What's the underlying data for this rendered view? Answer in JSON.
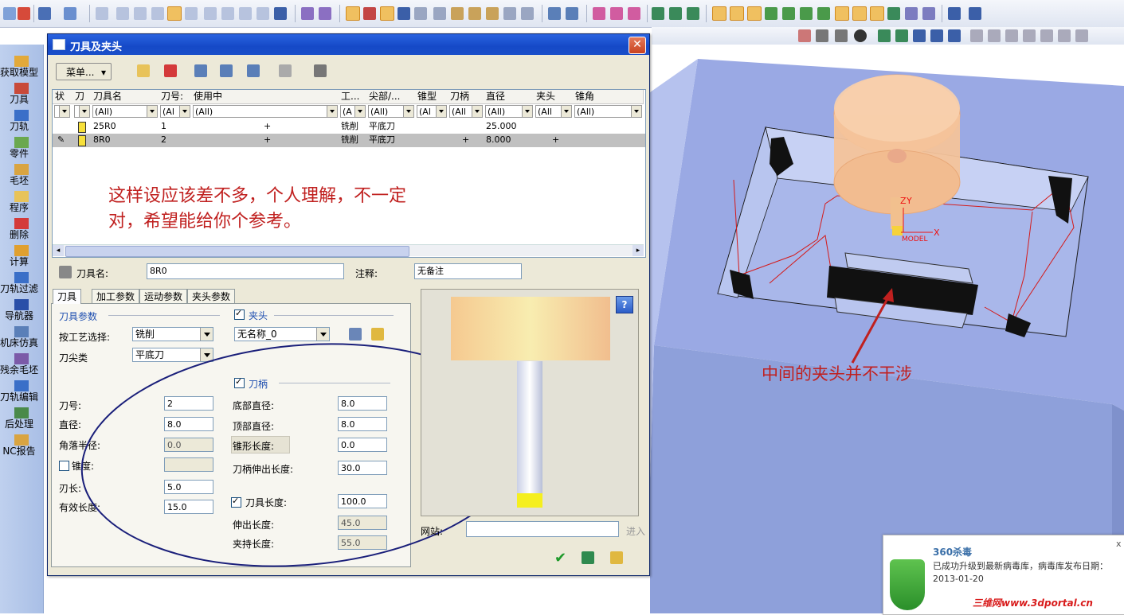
{
  "dialog": {
    "title": "刀具及夹头",
    "menu_button": "菜单...",
    "table": {
      "headers": [
        "状",
        "刀",
        "刀具名",
        "刀号:",
        "使用中",
        "工...",
        "尖部/...",
        "锥型",
        "刀柄",
        "直径",
        "夹头",
        "锥角"
      ],
      "filters": [
        "",
        "",
        "(All)",
        "(Al",
        "(All)",
        "(A",
        "(All)",
        "(Al",
        "(All",
        "(All)",
        "(All",
        "(All)"
      ],
      "rows": [
        {
          "name": "25R0",
          "number": "1",
          "in_use": "+",
          "process": "铣削",
          "tip": "平底刀",
          "holder": "",
          "diameter": "25.000",
          "chuck": ""
        },
        {
          "name": "8R0",
          "number": "2",
          "in_use": "+",
          "process": "铣削",
          "tip": "平底刀",
          "holder": "+",
          "diameter": "8.000",
          "chuck": "+"
        }
      ]
    },
    "note_line1": "这样设应该差不多，个人理解，不一定",
    "note_line2": "对，希望能给你个参考。",
    "tool_name_label": "刀具名:",
    "tool_name_value": "8R0",
    "comment_label": "注释:",
    "comment_value": "无备注",
    "tabs": [
      "刀具",
      "加工参数",
      "运动参数",
      "夹头参数"
    ],
    "tool_params_title": "刀具参数",
    "process_select_label": "按工艺选择:",
    "process_select_value": "铣削",
    "tip_type_label": "刀尖类",
    "tip_type_value": "平底刀",
    "number_label": "刀号:",
    "number_value": "2",
    "diameter_label": "直径:",
    "diameter_value": "8.0",
    "corner_radius_label": "角落半径:",
    "corner_radius_value": "0.0",
    "taper_label": "锥度:",
    "taper_value": "",
    "flute_length_label": "刃长:",
    "flute_length_value": "5.0",
    "effective_length_label": "有效长度:",
    "effective_length_value": "15.0",
    "chuck_label": "夹头",
    "chuck_value": "无名称_0",
    "shank_label": "刀柄",
    "bottom_dia_label": "底部直径:",
    "bottom_dia_value": "8.0",
    "top_dia_label": "顶部直径:",
    "top_dia_value": "8.0",
    "taper_length_label": "锥形长度:",
    "taper_length_value": "0.0",
    "shank_extension_label": "刀柄伸出长度:",
    "shank_extension_value": "30.0",
    "tool_length_label": "刀具长度:",
    "tool_length_value": "100.0",
    "extension_label": "伸出长度:",
    "extension_value": "45.0",
    "clamp_label": "夹持长度:",
    "clamp_value": "55.0",
    "website_label": "网站:",
    "website_value": "",
    "go_label": "进入",
    "help_label": "?"
  },
  "sidebar": {
    "items": [
      "获取模型",
      "刀具",
      "刀轨",
      "零件",
      "毛坯",
      "程序",
      "删除",
      "计算",
      "刀轨过滤",
      "导航器",
      "机床仿真",
      "残余毛坯",
      "刀轨编辑",
      "后处理",
      "NC报告"
    ]
  },
  "viewport": {
    "annotation": "中间的夹头并不干涉",
    "axis_z": "Z",
    "axis_y": "Y",
    "axis_x": "X",
    "model_label": "MODEL"
  },
  "popup": {
    "title": "360杀毒",
    "message": "已成功升级到最新病毒库，病毒库发布日期：",
    "date": "2013-01-20",
    "close": "x"
  },
  "watermark": "三维网www.3dportal.cn",
  "colors": {
    "title_blue": "#1549c7",
    "note_red": "#c0201f",
    "ellipse_navy": "#1a1f7a",
    "part_blue": "#9aa9e4"
  }
}
